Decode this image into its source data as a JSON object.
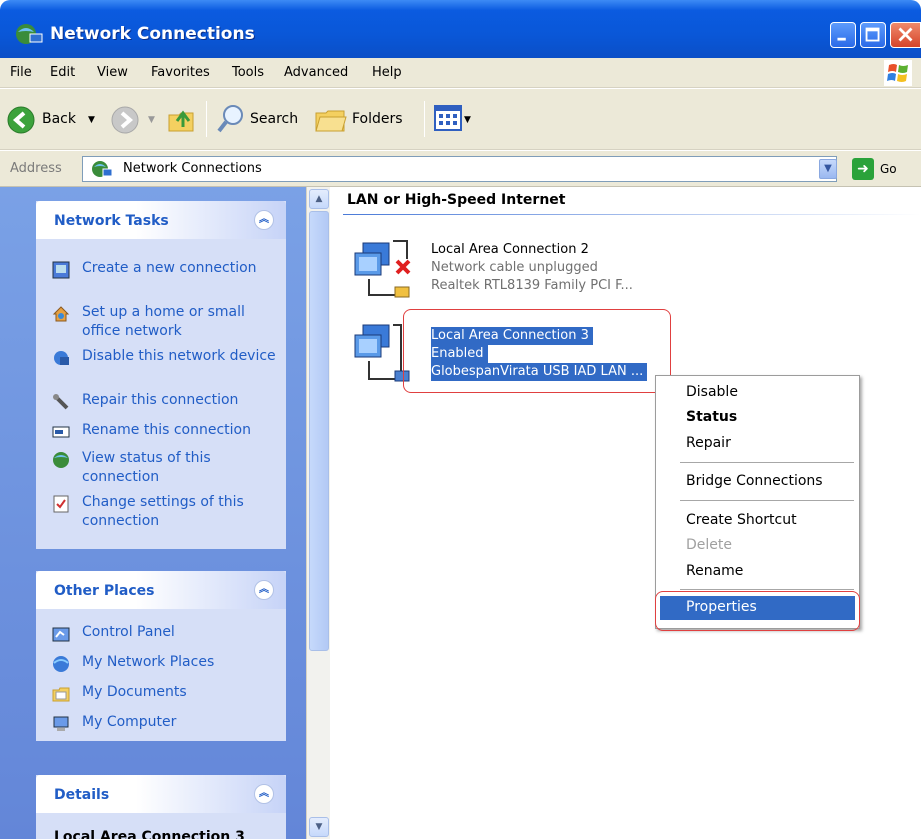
{
  "window": {
    "title": "Network Connections"
  },
  "menubar": {
    "items": [
      "File",
      "Edit",
      "View",
      "Favorites",
      "Tools",
      "Advanced",
      "Help"
    ]
  },
  "toolbar": {
    "back": "Back",
    "search": "Search",
    "folders": "Folders"
  },
  "address": {
    "label": "Address",
    "value": "Network Connections",
    "go": "Go"
  },
  "taskpane": {
    "network_tasks": {
      "title": "Network Tasks",
      "items": [
        "Create a new connection",
        "Set up a home or small office network",
        "Disable this network device",
        "Repair this connection",
        "Rename this connection",
        "View status of this connection",
        "Change settings of this connection"
      ]
    },
    "other_places": {
      "title": "Other Places",
      "items": [
        "Control Panel",
        "My Network Places",
        "My Documents",
        "My Computer"
      ]
    },
    "details": {
      "title": "Details",
      "partial": "Local Area Connection 3"
    }
  },
  "content": {
    "group_title": "LAN or High-Speed Internet",
    "connections": [
      {
        "name": "Local Area Connection 2",
        "status": "Network cable unplugged",
        "device": "Realtek RTL8139 Family PCI F..."
      },
      {
        "name": "Local Area Connection 3",
        "status": "Enabled",
        "device": "GlobespanVirata USB IAD LAN ..."
      }
    ]
  },
  "context_menu": {
    "items": [
      "Disable",
      "Status",
      "Repair",
      "Bridge Connections",
      "Create Shortcut",
      "Delete",
      "Rename",
      "Properties"
    ]
  }
}
